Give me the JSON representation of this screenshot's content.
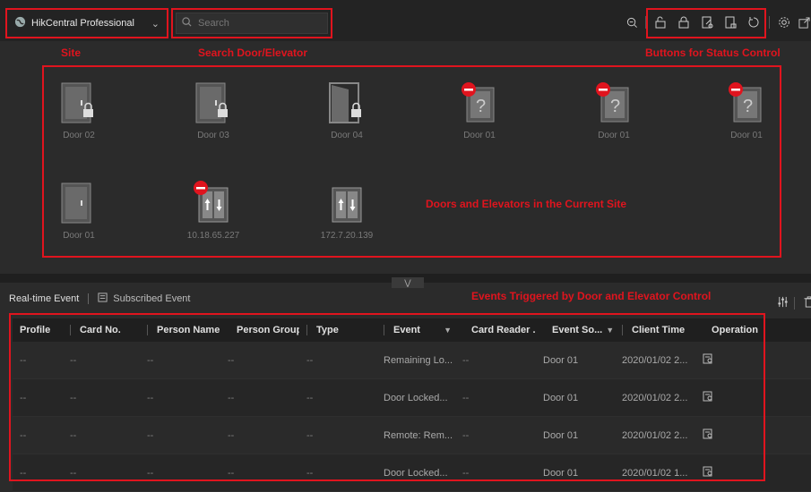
{
  "toolbar": {
    "site_name": "HikCentral Professional",
    "search_placeholder": "Search",
    "icons": [
      "zoom-out-icon",
      "unlock-icon",
      "lock-icon",
      "remain-open-icon",
      "remain-locked-icon",
      "restore-icon",
      "settings-icon",
      "popout-icon"
    ]
  },
  "annotations": {
    "site": "Site",
    "search": "Search Door/Elevator",
    "status": "Buttons for Status Control",
    "doors": "Doors and Elevators in the Current Site",
    "events": "Events Triggered by Door and Elevator Control"
  },
  "doors": [
    {
      "name": "Door 02",
      "kind": "door-locked"
    },
    {
      "name": "Door 03",
      "kind": "door-locked"
    },
    {
      "name": "Door 04",
      "kind": "door-open-locked"
    },
    {
      "name": "Door 01",
      "kind": "door-offline"
    },
    {
      "name": "Door 01",
      "kind": "door-offline"
    },
    {
      "name": "Door 01",
      "kind": "door-offline"
    },
    {
      "name": "Door 01",
      "kind": "door-closed"
    },
    {
      "name": "10.18.65.227",
      "kind": "elevator-offline"
    },
    {
      "name": "172.7.20.139",
      "kind": "elevator"
    }
  ],
  "events": {
    "tab_realtime": "Real-time Event",
    "tab_subscribed": "Subscribed Event",
    "columns": [
      "Profile",
      "Card No.",
      "Person Name",
      "Person Group",
      "Type",
      "Event",
      "Card Reader ...",
      "Event So...",
      "Client Time",
      "Operation"
    ],
    "rows": [
      [
        "--",
        "--",
        "--",
        "--",
        "--",
        "Remaining Lo...",
        "--",
        "Door 01",
        "2020/01/02 2..."
      ],
      [
        "--",
        "--",
        "--",
        "--",
        "--",
        "Door Locked...",
        "--",
        "Door 01",
        "2020/01/02 2..."
      ],
      [
        "--",
        "--",
        "--",
        "--",
        "--",
        "Remote: Rem...",
        "--",
        "Door 01",
        "2020/01/02 2..."
      ],
      [
        "--",
        "--",
        "--",
        "--",
        "--",
        "Door Locked...",
        "--",
        "Door 01",
        "2020/01/02 1..."
      ]
    ]
  },
  "colors": {
    "annotation": "#e0141e",
    "background": "#2b2b2b",
    "toolbar": "#232323"
  }
}
